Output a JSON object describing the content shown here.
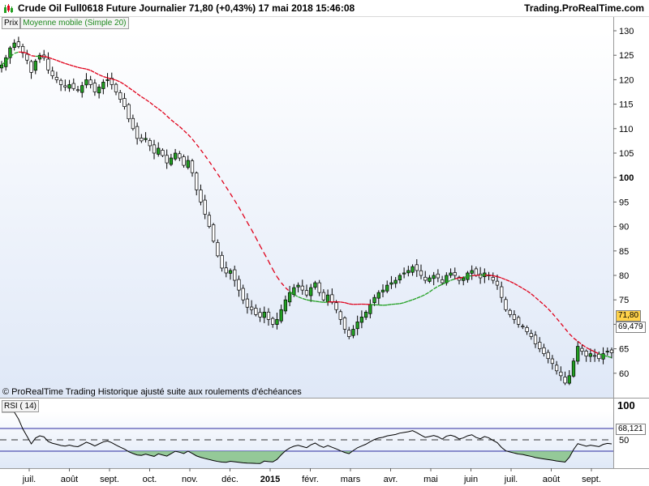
{
  "header": {
    "title": "Crude Oil Full0618 Future   Journalier   71,80 (+0,43%)   17 mai 2018 15:46:08",
    "site": "Trading.ProRealTime.com"
  },
  "legend": {
    "price_label": "Prix",
    "ma_label": "Moyenne mobile (Simple 20)",
    "rsi_label": "RSI ( 14)"
  },
  "footnote": "© ProRealTime Trading  Historique ajusté suite aux roulements d'échéances",
  "tags": {
    "last_price": "71,80",
    "ma_value": "69,479",
    "rsi_value": "68,121"
  },
  "colors": {
    "up_candle": "#22a022",
    "down_candle": "#000000",
    "ma_above": "#e0001a",
    "ma_below": "#22a022",
    "rsi_line": "#000000",
    "rsi_band": "#2a2aa0",
    "rsi_fill_low": "#7fbf7f",
    "background_top": "#ffffff",
    "background_bottom": "#dfe8f7",
    "price_tag": "#ffd24a"
  },
  "chart_data": {
    "type": "candlestick",
    "price_axis": {
      "ylim": [
        55,
        130
      ],
      "ticks": [
        130,
        125,
        120,
        115,
        110,
        105,
        100,
        95,
        90,
        85,
        80,
        75,
        70,
        65,
        60
      ],
      "tick_labels": [
        "130",
        "125",
        "120",
        "115",
        "110",
        "105",
        "100",
        "95",
        "90",
        "85",
        "80",
        "75",
        "70",
        "65",
        "60"
      ]
    },
    "rsi_axis": {
      "ylim": [
        0,
        100
      ],
      "ticks": [
        100,
        50
      ],
      "tick_labels": [
        "100",
        "50"
      ],
      "bands": [
        30,
        70
      ]
    },
    "x_axis": {
      "labels": [
        "juil.",
        "août",
        "sept.",
        "oct.",
        "nov.",
        "déc.",
        "2015",
        "févr.",
        "mars",
        "avr.",
        "mai",
        "juin",
        "juil.",
        "août",
        "sept."
      ],
      "bold_labels": [
        "2015"
      ]
    },
    "series": [
      {
        "name": "Prix",
        "kind": "close_trend",
        "closes": [
          123.0,
          124.5,
          126.5,
          127.5,
          126.8,
          125.5,
          124.0,
          121.5,
          123.8,
          125.0,
          124.5,
          122.0,
          120.8,
          120.0,
          119.0,
          118.5,
          119.0,
          118.2,
          117.8,
          118.8,
          120.0,
          119.0,
          117.5,
          118.5,
          119.5,
          120.0,
          119.0,
          117.5,
          116.0,
          114.5,
          112.0,
          110.0,
          108.0,
          107.5,
          108.0,
          106.5,
          105.0,
          106.0,
          104.5,
          103.0,
          104.0,
          105.0,
          104.0,
          102.5,
          103.5,
          101.0,
          97.5,
          95.0,
          92.5,
          90.0,
          87.0,
          84.0,
          81.5,
          80.5,
          81.0,
          79.0,
          77.0,
          75.0,
          73.5,
          73.0,
          72.0,
          71.5,
          72.5,
          71.0,
          70.0,
          71.0,
          73.0,
          75.0,
          76.5,
          77.5,
          78.0,
          77.0,
          76.0,
          77.5,
          78.5,
          76.5,
          75.0,
          76.0,
          74.5,
          73.0,
          71.0,
          69.0,
          67.5,
          69.0,
          70.5,
          71.5,
          72.5,
          74.0,
          75.5,
          76.5,
          77.0,
          78.0,
          78.5,
          79.0,
          80.0,
          80.5,
          81.0,
          81.8,
          81.0,
          80.0,
          79.0,
          79.5,
          80.0,
          79.5,
          78.5,
          80.0,
          80.5,
          80.0,
          79.0,
          79.5,
          80.5,
          81.0,
          80.0,
          79.5,
          80.5,
          80.0,
          79.0,
          78.0,
          75.5,
          73.0,
          72.0,
          71.0,
          70.0,
          69.5,
          68.5,
          67.5,
          66.0,
          65.0,
          64.0,
          63.0,
          62.0,
          60.5,
          59.5,
          58.0,
          59.5,
          62.5,
          65.5,
          64.5,
          63.5,
          64.0,
          63.5,
          63.0,
          64.0,
          64.5,
          64.2
        ]
      },
      {
        "name": "Moyenne mobile (Simple 20)",
        "kind": "simple_moving_average",
        "period": 20
      },
      {
        "name": "RSI ( 14)",
        "kind": "rsi",
        "period": 14
      }
    ]
  }
}
